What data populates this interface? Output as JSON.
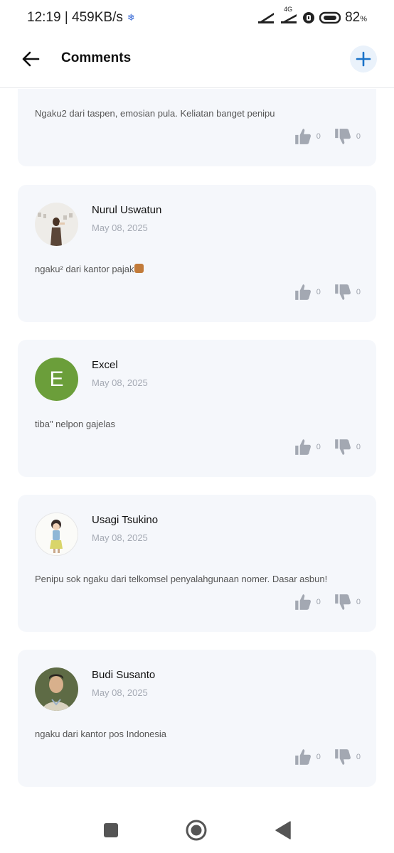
{
  "status_bar": {
    "time_speed": "12:19 | 459KB/s",
    "network_label": "4G",
    "battery": "82",
    "battery_unit": "%"
  },
  "header": {
    "title": "Comments"
  },
  "comments": [
    {
      "name": "",
      "date": "",
      "text": "Ngaku2 dari taspen, emosian pula. Keliatan banget penipu",
      "likes": "0",
      "dislikes": "0"
    },
    {
      "name": "Nurul Uswatun",
      "date": "May 08, 2025",
      "text": "ngaku² dari kantor pajak",
      "likes": "0",
      "dislikes": "0"
    },
    {
      "name": "Excel",
      "avatar_letter": "E",
      "avatar_color": "#6b9e3a",
      "date": "May 08, 2025",
      "text": "tiba\" nelpon gajelas",
      "likes": "0",
      "dislikes": "0"
    },
    {
      "name": "Usagi Tsukino",
      "date": "May 08, 2025",
      "text": "Penipu sok ngaku dari telkomsel penyalahgunaan nomer. Dasar asbun!",
      "likes": "0",
      "dislikes": "0"
    },
    {
      "name": "Budi Susanto",
      "date": "May 08, 2025",
      "text": "ngaku dari kantor pos Indonesia",
      "likes": "0",
      "dislikes": "0"
    }
  ],
  "colors": {
    "accent": "#1a73c9",
    "card_bg": "#f5f7fb",
    "icon_gray": "#a3a8b2"
  },
  "icons": {
    "back": "arrow-left-icon",
    "add": "plus-icon",
    "like": "thumbs-up-icon",
    "dislike": "thumbs-down-icon"
  }
}
